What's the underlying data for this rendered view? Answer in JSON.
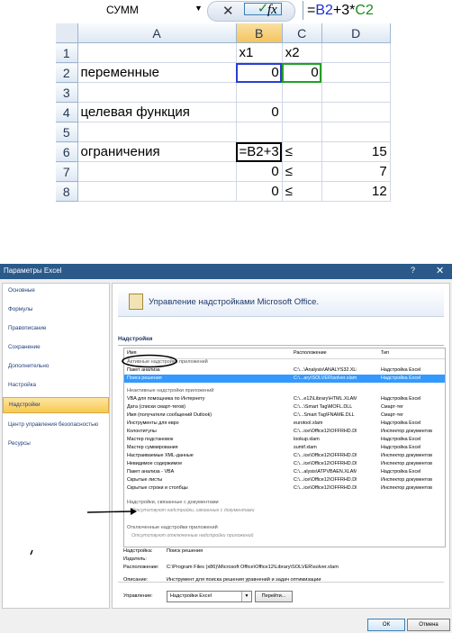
{
  "excel": {
    "name_box": "СУММ",
    "formula_buttons": {
      "cancel": "✕",
      "enter": "✓",
      "fx": "fx"
    },
    "formula": {
      "eq": "=",
      "ref1": "B2",
      "op": "+3*",
      "ref2": "C2"
    },
    "columns": [
      "A",
      "B",
      "C",
      "D"
    ],
    "rows": [
      {
        "num": "1",
        "a": "",
        "b": "x1",
        "c": "x2",
        "d": ""
      },
      {
        "num": "2",
        "a": "переменные",
        "b": "0",
        "c": "0",
        "d": ""
      },
      {
        "num": "3",
        "a": "",
        "b": "",
        "c": "",
        "d": ""
      },
      {
        "num": "4",
        "a": "целевая функция",
        "b": "0",
        "c": "",
        "d": ""
      },
      {
        "num": "5",
        "a": "",
        "b": "",
        "c": "",
        "d": ""
      },
      {
        "num": "6",
        "a": "ограничения",
        "b": "=B2+3",
        "c": "≤",
        "d": "15"
      },
      {
        "num": "7",
        "a": "",
        "b": "0",
        "c": "≤",
        "d": "7"
      },
      {
        "num": "8",
        "a": "",
        "b": "0",
        "c": "≤",
        "d": "12"
      }
    ]
  },
  "dialog": {
    "title": "Параметры Excel",
    "help": "?",
    "close": "✕",
    "nav": [
      "Основные",
      "Формулы",
      "Правописание",
      "Сохранение",
      "Дополнительно",
      "Настройка",
      "Надстройки",
      "Центр управления безопасностью",
      "Ресурсы"
    ],
    "banner_title": "Управление надстройками Microsoft Office.",
    "section_title": "Надстройки",
    "columns": {
      "name": "Имя",
      "location": "Расположение",
      "type": "Тип"
    },
    "groups": {
      "active": "Активные надстройки приложений",
      "inactive": "Неактивные надстройки приложений",
      "document": "Надстройки, связанные с документами",
      "document_empty": "Отсутствуют надстройки, связанные с документами",
      "disabled": "Отключенные надстройки приложений",
      "disabled_empty": "Отсутствуют отключенные надстройки приложений"
    },
    "active_items": [
      {
        "name": "Пакет анализа",
        "loc": "C:\\...\\Analysis\\ANALYS32.XLL",
        "type": "Надстройка Excel"
      },
      {
        "name": "Поиск решения",
        "loc": "C:\\...ary\\SOLVER\\solver.xlam",
        "type": "Надстройка Excel"
      }
    ],
    "inactive_items": [
      {
        "name": "VBA для помощника по Интернету",
        "loc": "C:\\...e12\\Library\\HTML.XLAM",
        "type": "Надстройка Excel"
      },
      {
        "name": "Дата (списки смарт-тегов)",
        "loc": "C:\\...\\Smart Tag\\MOFL.DLL",
        "type": "Смарт-тег"
      },
      {
        "name": "Имя (получатели сообщений Outlook)",
        "loc": "C:\\...Smart Tag\\FNAME.DLL",
        "type": "Смарт-тег"
      },
      {
        "name": "Инструменты для евро",
        "loc": "eurotool.xlam",
        "type": "Надстройка Excel"
      },
      {
        "name": "Колонтитулы",
        "loc": "C:\\...ice\\Office12\\OFFRHD.DLL",
        "type": "Инспектор документов"
      },
      {
        "name": "Мастер подстановок",
        "loc": "lookup.xlam",
        "type": "Надстройка Excel"
      },
      {
        "name": "Мастер суммирования",
        "loc": "sumif.xlam",
        "type": "Надстройка Excel"
      },
      {
        "name": "Настраиваемые XML-данные",
        "loc": "C:\\...ice\\Office12\\OFFRHD.DLL",
        "type": "Инспектор документов"
      },
      {
        "name": "Невидимое содержимое",
        "loc": "C:\\...ice\\Office12\\OFFRHD.DLL",
        "type": "Инспектор документов"
      },
      {
        "name": "Пакет анализа - VBA",
        "loc": "C:\\...alysis\\ATPVBAEN.XLAM",
        "type": "Надстройка Excel"
      },
      {
        "name": "Скрытые листы",
        "loc": "C:\\...ice\\Office12\\OFFRHD.DLL",
        "type": "Инспектор документов"
      },
      {
        "name": "Скрытые строки и столбцы",
        "loc": "C:\\...ice\\Office12\\OFFRHD.DLL",
        "type": "Инспектор документов"
      }
    ],
    "details": {
      "addin_label": "Надстройка:",
      "addin_value": "Поиск решения",
      "publisher_label": "Издатель:",
      "publisher_value": "",
      "location_label": "Расположение:",
      "location_value": "C:\\Program Files (x86)\\Microsoft Office\\Office12\\Library\\SOLVER\\solver.xlam",
      "description_label": "Описание:",
      "description_value": "Инструмент для поиска решения уравнений и задач оптимизации"
    },
    "manage_label": "Управление:",
    "manage_value": "Надстройки Excel",
    "go_button": "Перейти...",
    "ok": "ОК",
    "cancel": "Отмена"
  }
}
